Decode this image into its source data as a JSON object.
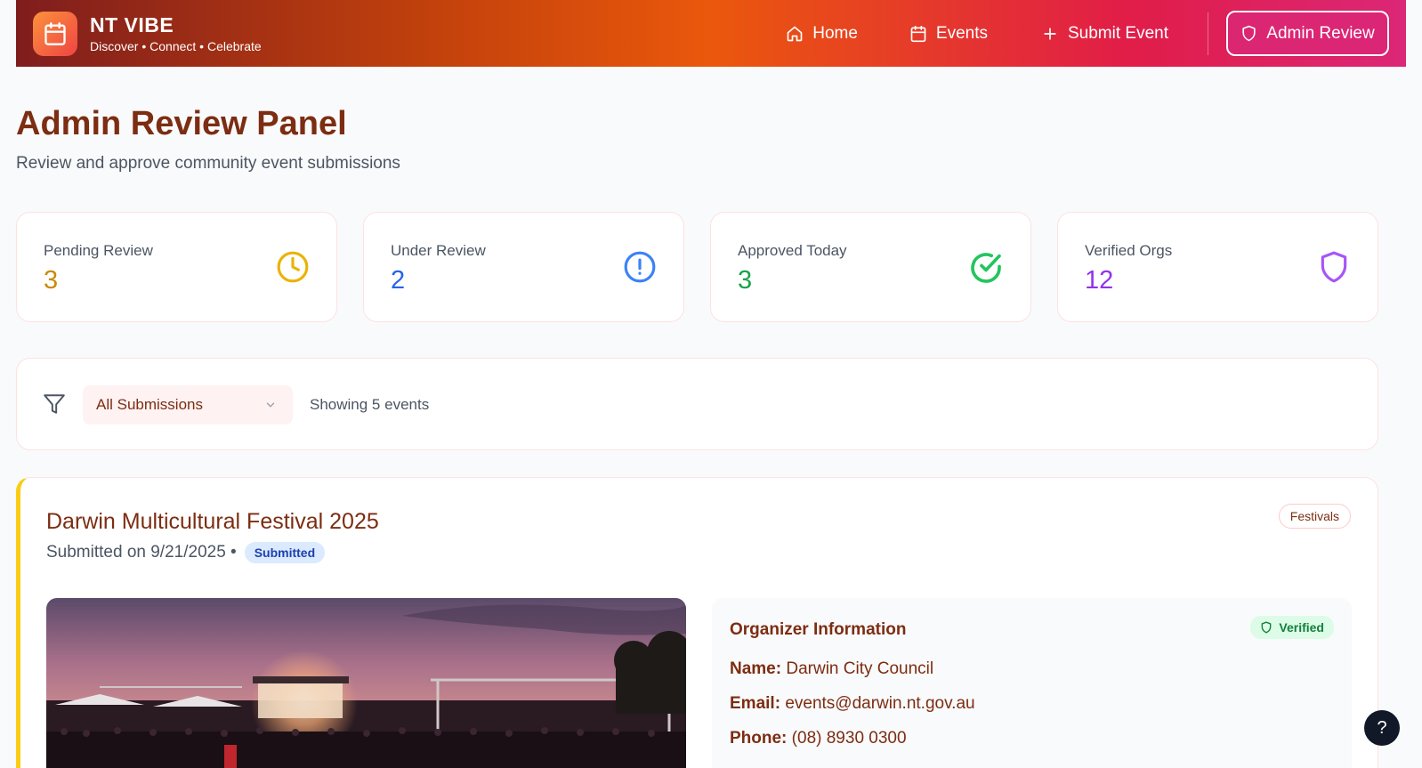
{
  "header": {
    "brand_title": "NT VIBE",
    "brand_subtitle": "Discover • Connect • Celebrate",
    "nav": {
      "home": "Home",
      "events": "Events",
      "submit": "Submit Event",
      "admin": "Admin Review"
    }
  },
  "page": {
    "title": "Admin Review Panel",
    "subtitle": "Review and approve community event submissions"
  },
  "stats": [
    {
      "label": "Pending Review",
      "value": "3",
      "color": "#ca8a04",
      "icon": "clock-icon"
    },
    {
      "label": "Under Review",
      "value": "2",
      "color": "#2563eb",
      "icon": "alert-circle-icon"
    },
    {
      "label": "Approved Today",
      "value": "3",
      "color": "#16a34a",
      "icon": "check-circle-icon"
    },
    {
      "label": "Verified Orgs",
      "value": "12",
      "color": "#9333ea",
      "icon": "shield-icon"
    }
  ],
  "filter": {
    "selected": "All Submissions",
    "count_text": "Showing 5 events"
  },
  "event": {
    "title": "Darwin Multicultural Festival 2025",
    "submitted_text": "Submitted on 9/21/2025 •",
    "status": "Submitted",
    "category": "Festivals",
    "organizer": {
      "heading": "Organizer Information",
      "verified": "Verified",
      "name_label": "Name:",
      "name": "Darwin City Council",
      "email_label": "Email:",
      "email": "events@darwin.nt.gov.au",
      "phone_label": "Phone:",
      "phone": "(08) 8930 0300"
    }
  },
  "help": "?"
}
